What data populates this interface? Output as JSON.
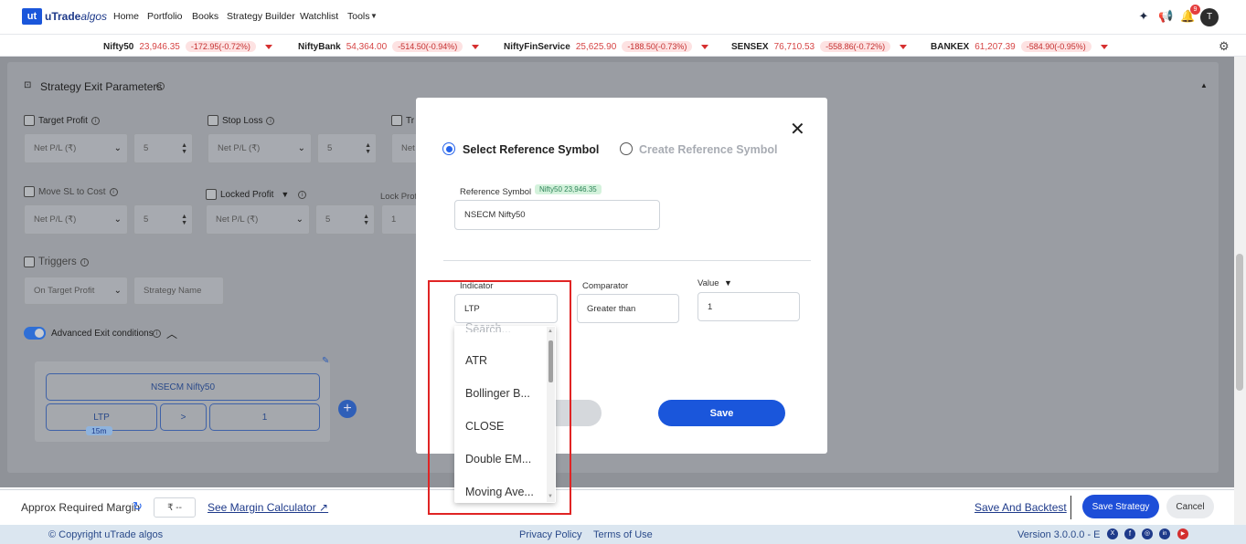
{
  "nav": {
    "logo_mark": "ut",
    "logo_brand": "uTrade",
    "logo_suffix": "algos",
    "items": [
      "Home",
      "Portfolio",
      "Books",
      "Strategy Builder",
      "Watchlist",
      "Tools"
    ],
    "notification_count": "9",
    "avatar_initial": "T"
  },
  "ticker": [
    {
      "name": "Nifty50",
      "value": "23,946.35",
      "change": "-172.95(-0.72%)"
    },
    {
      "name": "NiftyBank",
      "value": "54,364.00",
      "change": "-514.50(-0.94%)"
    },
    {
      "name": "NiftyFinService",
      "value": "25,625.90",
      "change": "-188.50(-0.73%)"
    },
    {
      "name": "SENSEX",
      "value": "76,710.53",
      "change": "-558.86(-0.72%)"
    },
    {
      "name": "BANKEX",
      "value": "61,207.39",
      "change": "-584.90(-0.95%)"
    }
  ],
  "exit_params": {
    "title": "Strategy Exit Parameters",
    "target_profit": "Target Profit",
    "stop_loss": "Stop Loss",
    "trail_cut": "Tr",
    "net_pl": "Net P/L (₹)",
    "net_cut": "Net",
    "qty": "5",
    "move_sl": "Move SL to Cost",
    "locked_profit": "Locked Profit",
    "lock_profit_cut": "Lock Profi",
    "lock_val": "1",
    "triggers": "Triggers",
    "on_target": "On Target Profit",
    "strategy_name_ph": "Strategy Name",
    "advanced": "Advanced Exit conditions",
    "cond_symbol": "NSECM Nifty50",
    "cond_indicator": "LTP",
    "cond_interval": "15m",
    "cond_comparator": ">",
    "cond_value": "1"
  },
  "bottom": {
    "margin_label": "Approx Required Margin",
    "margin_value": "₹ --",
    "margin_calc": "See Margin Calculator ↗",
    "save_backtest": "Save And Backtest",
    "save_strategy": "Save Strategy",
    "cancel": "Cancel"
  },
  "footer": {
    "copyright": "© Copyright uTrade algos",
    "privacy": "Privacy Policy",
    "terms": "Terms of Use",
    "version": "Version 3.0.0.0 - E"
  },
  "modal": {
    "opt_select": "Select Reference Symbol",
    "opt_create": "Create Reference Symbol",
    "ref_label": "Reference Symbol",
    "ref_badge": "Nifty50 23,946.35",
    "ref_value": "NSECM Nifty50",
    "indicator_label": "Indicator",
    "indicator_value": "LTP",
    "comparator_label": "Comparator",
    "comparator_value": "Greater than",
    "value_label": "Value",
    "value_value": "1",
    "save": "Save",
    "search_placeholder": "Search...",
    "options": [
      "ATR",
      "Bollinger B...",
      "CLOSE",
      "Double EM...",
      "Moving Ave..."
    ]
  },
  "colors": {
    "primary": "#2563eb",
    "overlay": "#8f9298",
    "highlight": "#e02424",
    "negative": "#d64545"
  }
}
